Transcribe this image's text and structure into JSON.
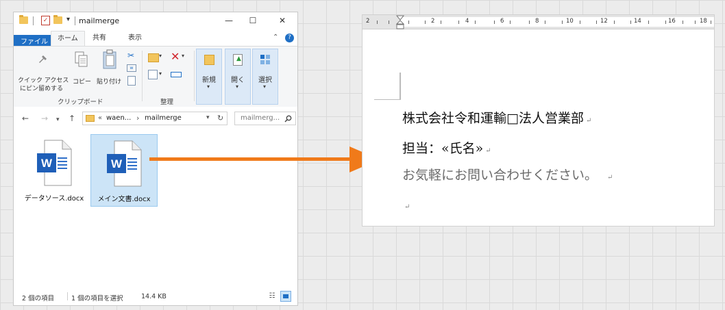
{
  "explorer": {
    "title": "mailmerge",
    "tabs": {
      "file": "ファイル",
      "home": "ホーム",
      "share": "共有",
      "view": "表示"
    },
    "ribbon": {
      "pin_label_1": "クイック アクセス",
      "pin_label_2": "にピン留めする",
      "copy": "コピー",
      "paste": "貼り付け",
      "clipboard_group": "クリップボード",
      "organize_group": "整理",
      "new": "新規",
      "open": "開く",
      "select": "選択"
    },
    "address": {
      "crumbs_prefix": "«",
      "crumb1": "waen...",
      "crumb_sep": "›",
      "crumb2": "mailmerge",
      "search_placeholder": "mailmerg..."
    },
    "files": [
      {
        "name": "データソース.docx",
        "selected": false
      },
      {
        "name": "メイン文書.docx",
        "selected": true
      }
    ],
    "status": {
      "count": "2 個の項目",
      "selected": "1 個の項目を選択",
      "size": "14.4 KB"
    }
  },
  "word": {
    "ruler_numbers": [
      "2",
      "2",
      "4",
      "6",
      "8",
      "10",
      "12",
      "14",
      "16",
      "18"
    ],
    "lines": [
      "株式会社令和運輸□法人営業部",
      "担当：«氏名»",
      "お気軽にお問い合わせください。",
      ""
    ],
    "paragraph_mark": "↵"
  },
  "colors": {
    "accent_blue": "#1f6fc5",
    "arrow_orange": "#f07a1a",
    "word_blue": "#1f5fb8"
  }
}
